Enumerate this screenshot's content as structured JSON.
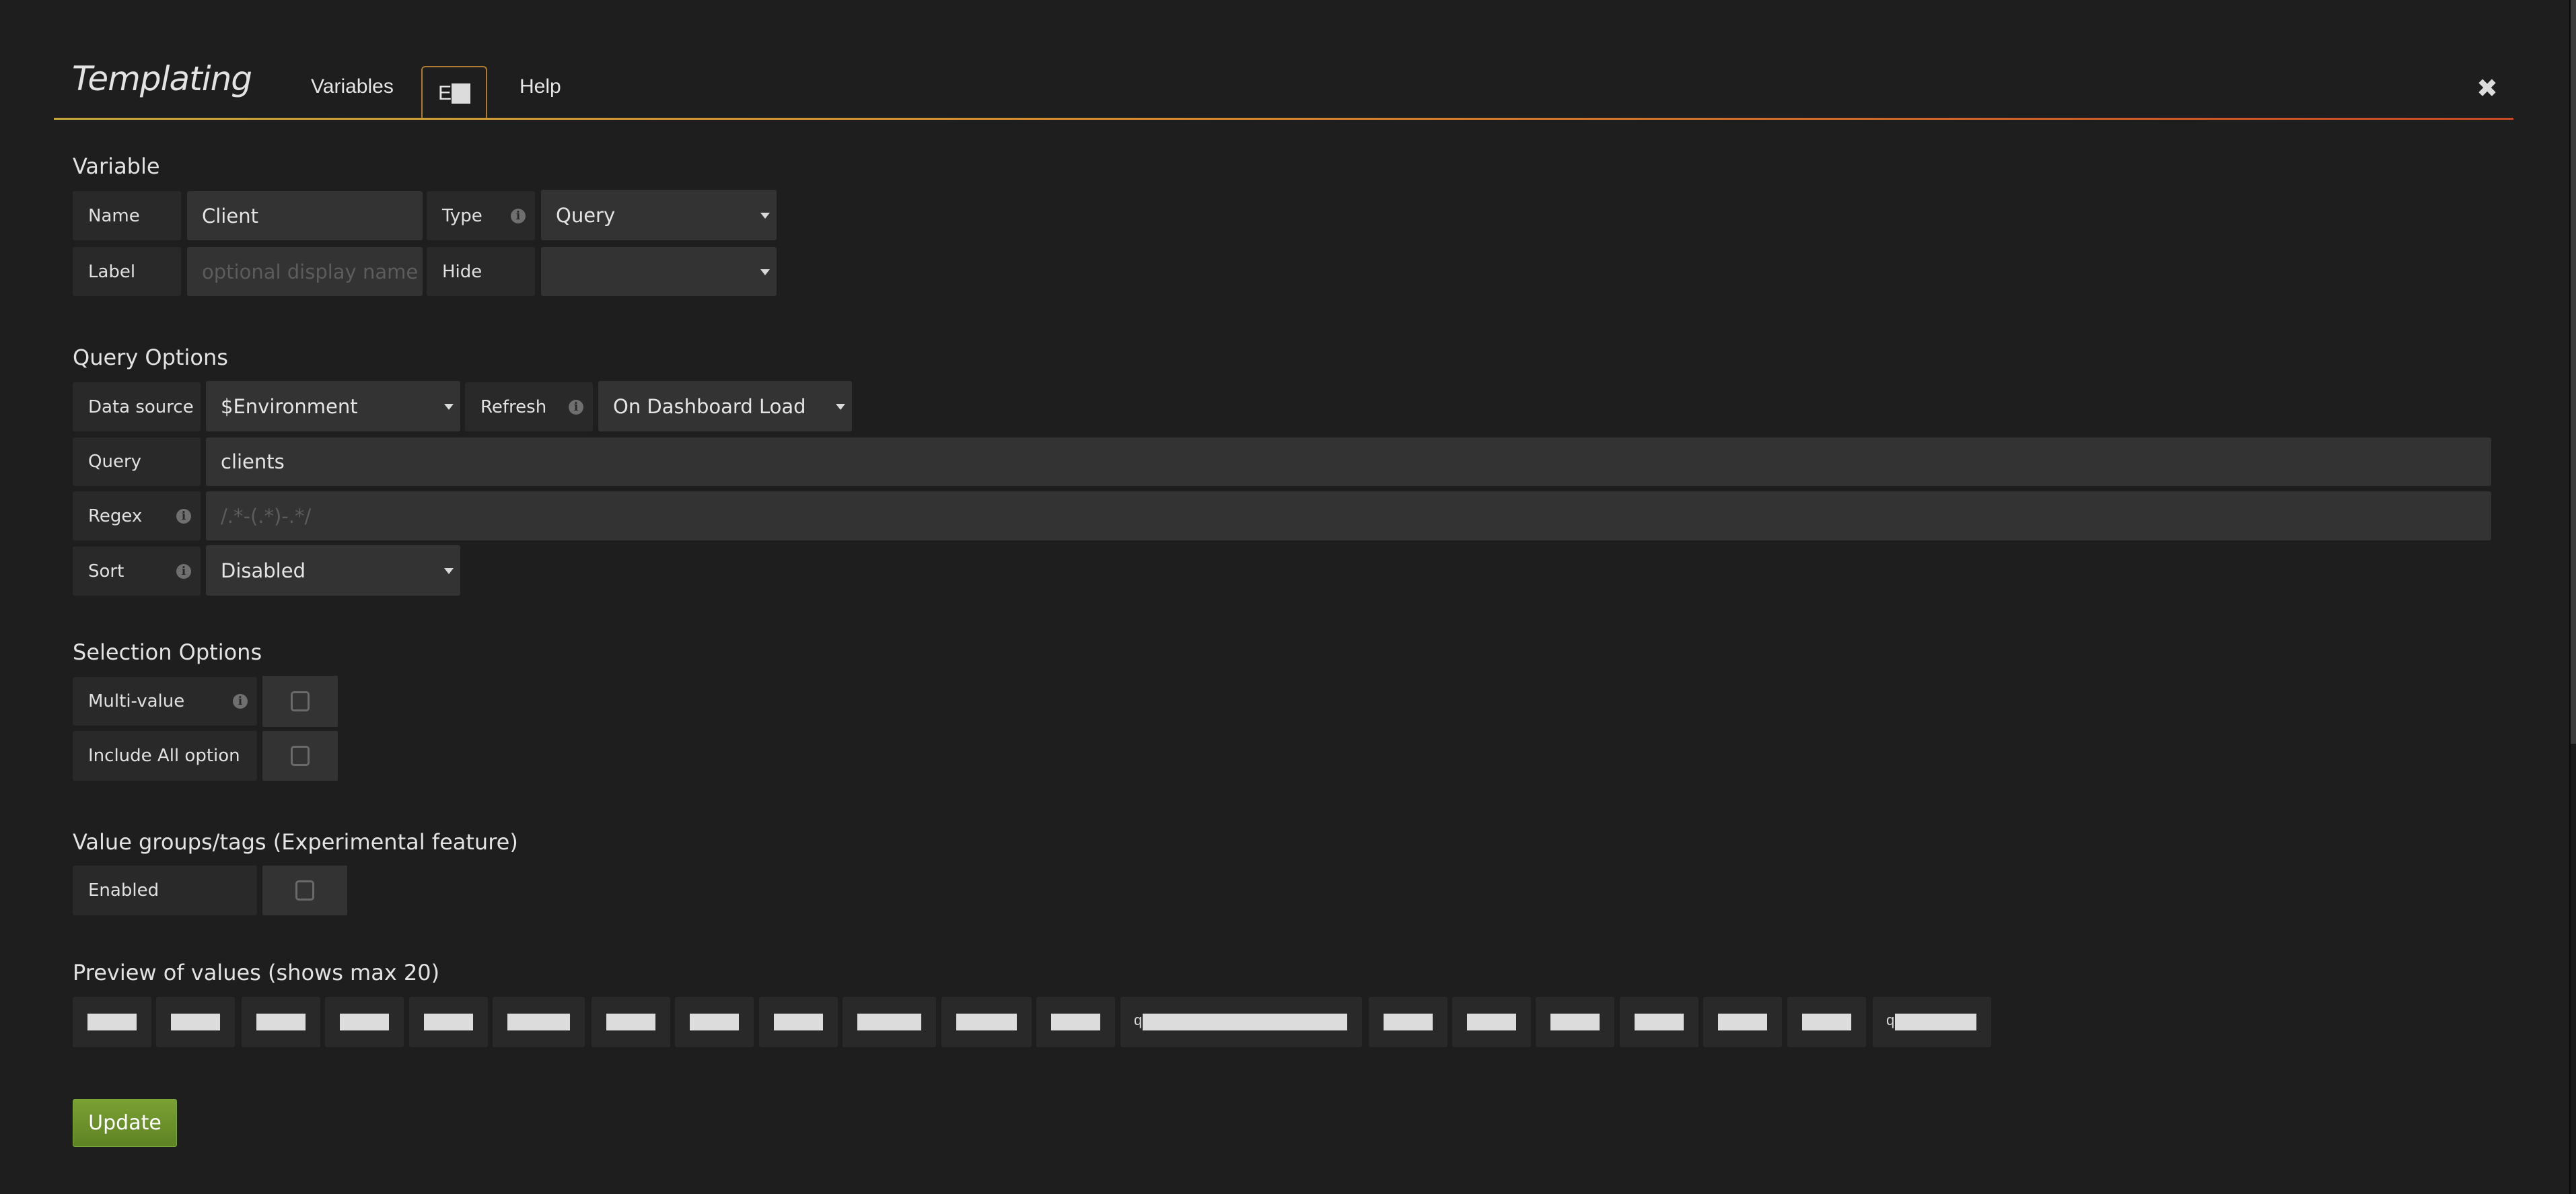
{
  "header": {
    "title": "Templating",
    "tabs": [
      {
        "label": "Variables",
        "active": false
      },
      {
        "label": "E",
        "active": true,
        "redacted": true
      },
      {
        "label": "Help",
        "active": false
      }
    ],
    "close_icon": "close-icon",
    "line_colors": [
      "#c7a53c",
      "#d98c2f",
      "#c94a26"
    ]
  },
  "variable": {
    "heading": "Variable",
    "name_label": "Name",
    "name_value": "Client",
    "type_label": "Type",
    "type_value": "Query",
    "label_label": "Label",
    "label_placeholder": "optional display name",
    "hide_label": "Hide",
    "hide_value": ""
  },
  "query_options": {
    "heading": "Query Options",
    "datasource_label": "Data source",
    "datasource_value": "$Environment",
    "refresh_label": "Refresh",
    "refresh_value": "On Dashboard Load",
    "query_label": "Query",
    "query_value": "clients",
    "regex_label": "Regex",
    "regex_placeholder": "/.*-(.*)-.*/",
    "sort_label": "Sort",
    "sort_value": "Disabled"
  },
  "selection_options": {
    "heading": "Selection Options",
    "multi_value_label": "Multi-value",
    "multi_value_checked": false,
    "include_all_label": "Include All option",
    "include_all_checked": false
  },
  "value_groups": {
    "heading": "Value groups/tags (Experimental feature)",
    "enabled_label": "Enabled",
    "enabled_checked": false
  },
  "preview": {
    "heading": "Preview of values (shows max 20)",
    "values": [
      {
        "prefix": "",
        "redacted": true
      },
      {
        "prefix": "",
        "redacted": true
      },
      {
        "prefix": "",
        "redacted": true
      },
      {
        "prefix": "",
        "redacted": true
      },
      {
        "prefix": "",
        "redacted": true
      },
      {
        "prefix": "",
        "redacted": true
      },
      {
        "prefix": "",
        "redacted": true
      },
      {
        "prefix": "",
        "redacted": true
      },
      {
        "prefix": "",
        "redacted": true
      },
      {
        "prefix": "",
        "redacted": true
      },
      {
        "prefix": "",
        "redacted": true
      },
      {
        "prefix": "",
        "redacted": true
      },
      {
        "prefix": "q",
        "redacted": true
      },
      {
        "prefix": "",
        "redacted": true
      },
      {
        "prefix": "",
        "redacted": true
      },
      {
        "prefix": "",
        "redacted": true
      },
      {
        "prefix": "",
        "redacted": true
      },
      {
        "prefix": "",
        "redacted": true
      },
      {
        "prefix": "",
        "redacted": true
      },
      {
        "prefix": "q",
        "redacted": true
      }
    ]
  },
  "actions": {
    "update_label": "Update",
    "update_color": "#6e9a2c"
  }
}
